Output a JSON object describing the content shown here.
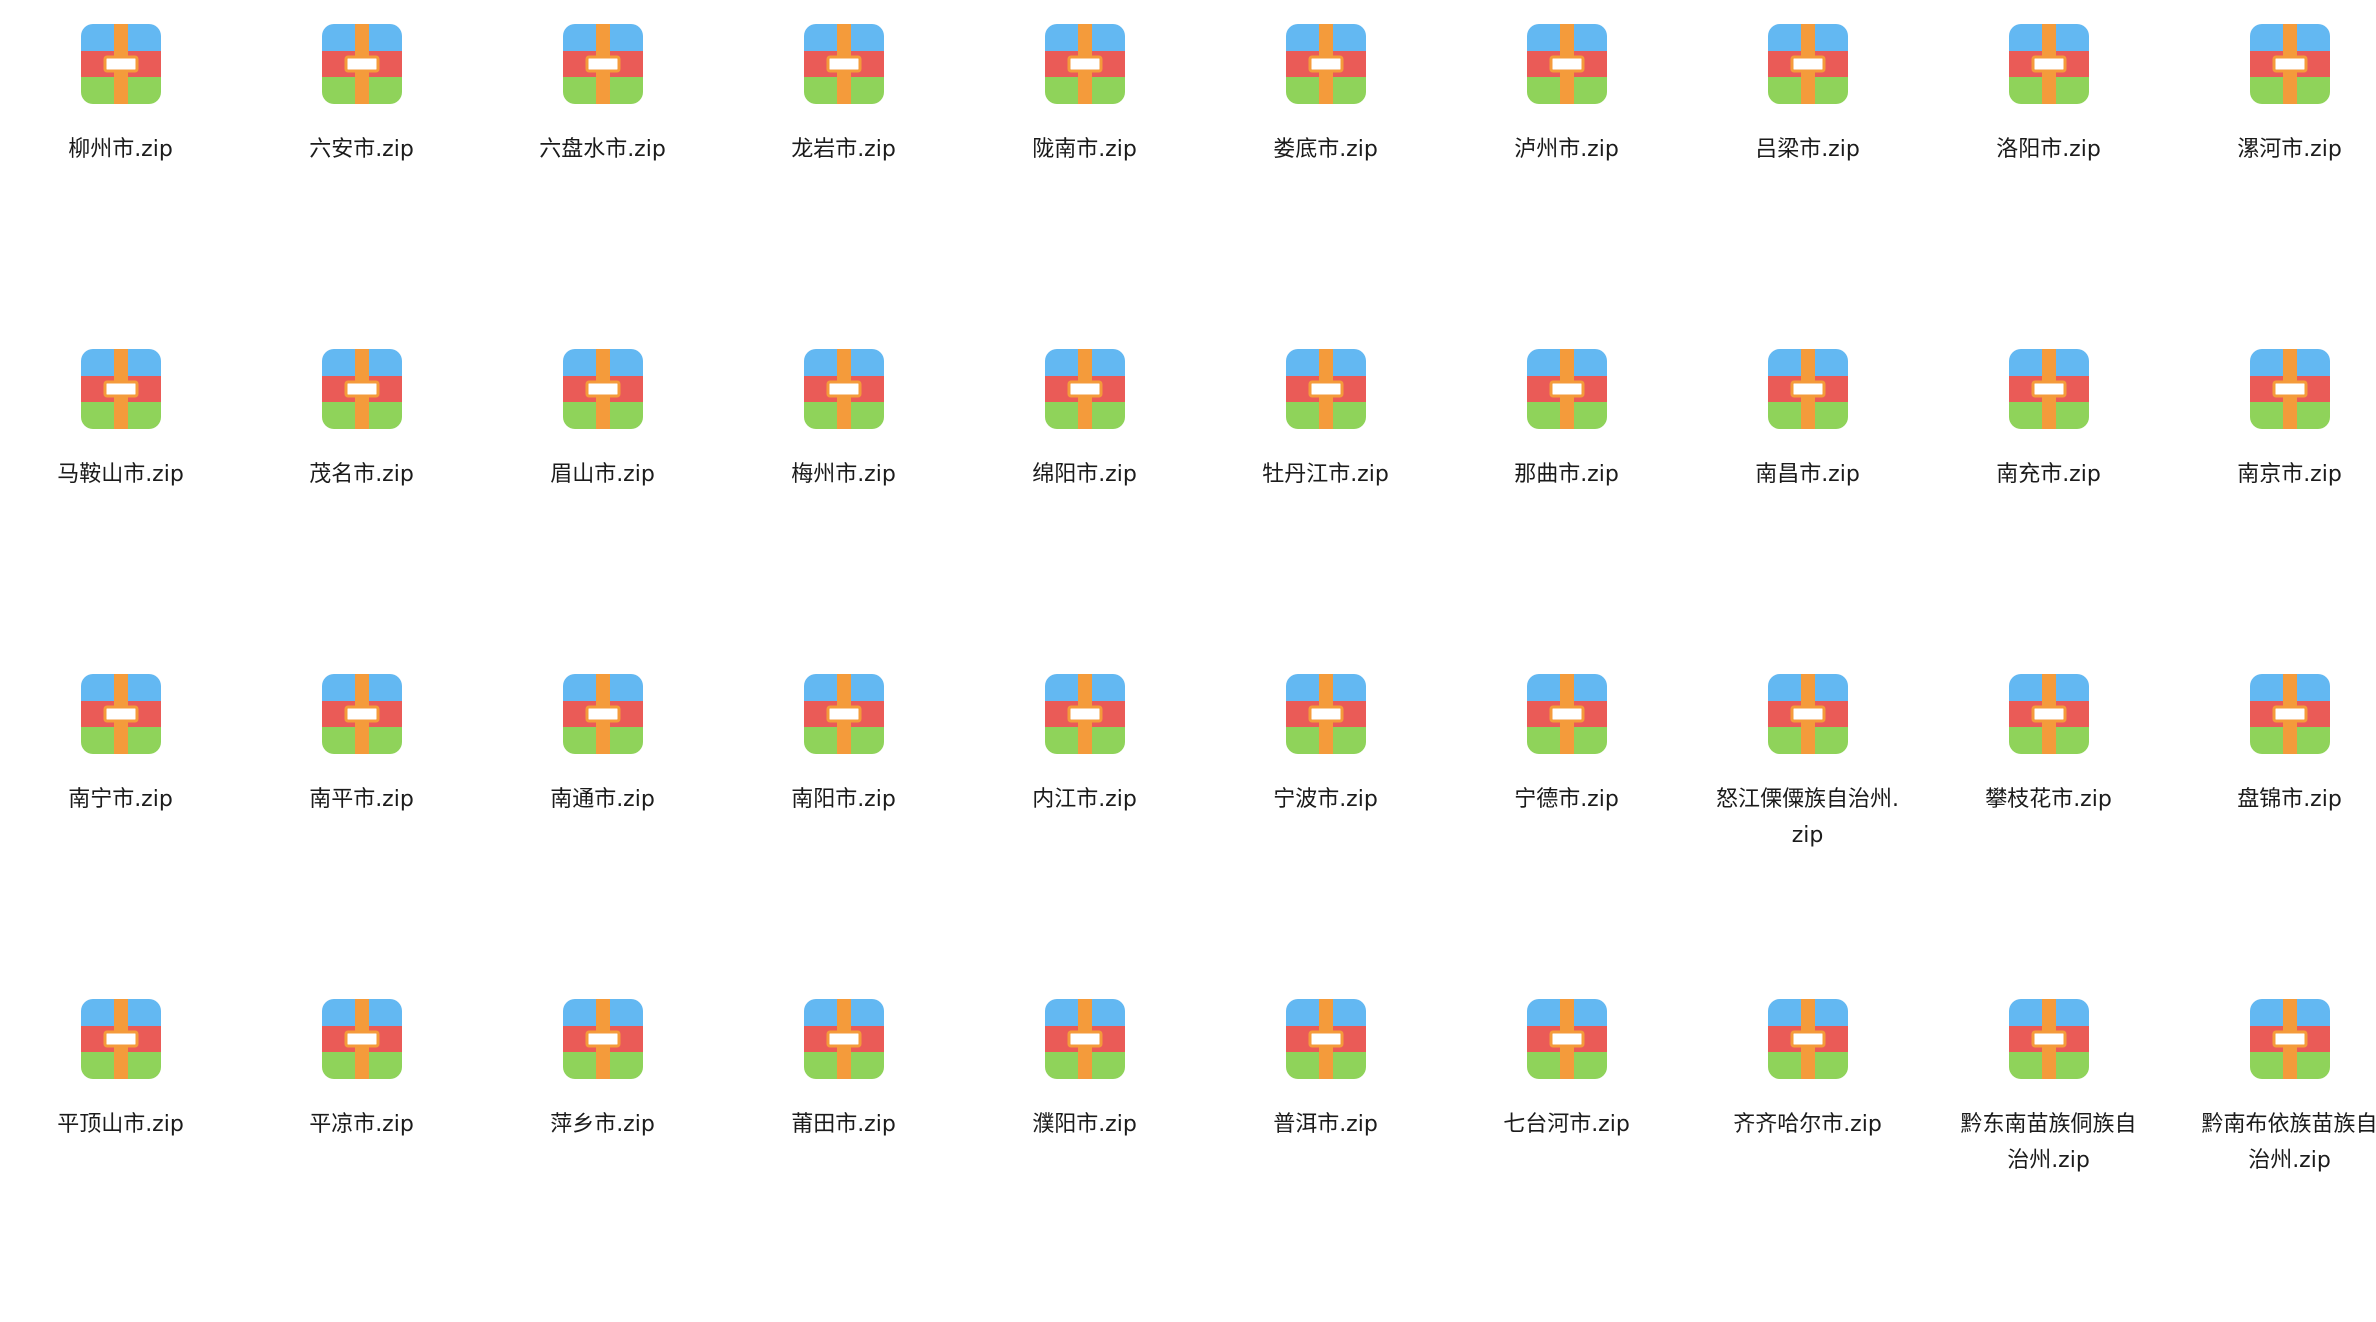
{
  "icon": {
    "name": "zip-archive-icon",
    "colors": {
      "top": "#63b8f2",
      "middle": "#ea5b57",
      "bottom": "#8fd35a",
      "strap": "#f49b3b",
      "buckle_fill": "#ffffff",
      "buckle_stroke": "#f49b3b"
    }
  },
  "files": [
    {
      "name": "柳州市.zip"
    },
    {
      "name": "六安市.zip"
    },
    {
      "name": "六盘水市.zip"
    },
    {
      "name": "龙岩市.zip"
    },
    {
      "name": "陇南市.zip"
    },
    {
      "name": "娄底市.zip"
    },
    {
      "name": "泸州市.zip"
    },
    {
      "name": "吕梁市.zip"
    },
    {
      "name": "洛阳市.zip"
    },
    {
      "name": "漯河市.zip"
    },
    {
      "name": "马鞍山市.zip"
    },
    {
      "name": "茂名市.zip"
    },
    {
      "name": "眉山市.zip"
    },
    {
      "name": "梅州市.zip"
    },
    {
      "name": "绵阳市.zip"
    },
    {
      "name": "牡丹江市.zip"
    },
    {
      "name": "那曲市.zip"
    },
    {
      "name": "南昌市.zip"
    },
    {
      "name": "南充市.zip"
    },
    {
      "name": "南京市.zip"
    },
    {
      "name": "南宁市.zip"
    },
    {
      "name": "南平市.zip"
    },
    {
      "name": "南通市.zip"
    },
    {
      "name": "南阳市.zip"
    },
    {
      "name": "内江市.zip"
    },
    {
      "name": "宁波市.zip"
    },
    {
      "name": "宁德市.zip"
    },
    {
      "name": "怒江傈僳族自治州.zip"
    },
    {
      "name": "攀枝花市.zip"
    },
    {
      "name": "盘锦市.zip"
    },
    {
      "name": "平顶山市.zip"
    },
    {
      "name": "平凉市.zip"
    },
    {
      "name": "萍乡市.zip"
    },
    {
      "name": "莆田市.zip"
    },
    {
      "name": "濮阳市.zip"
    },
    {
      "name": "普洱市.zip"
    },
    {
      "name": "七台河市.zip"
    },
    {
      "name": "齐齐哈尔市.zip"
    },
    {
      "name": "黔东南苗族侗族自治州.zip"
    },
    {
      "name": "黔南布依族苗族自治州.zip"
    }
  ]
}
